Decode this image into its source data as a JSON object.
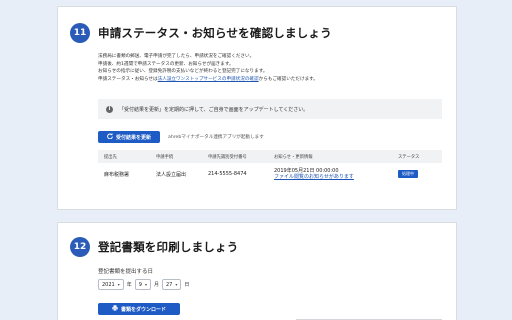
{
  "step11": {
    "number": "11",
    "title": "申請ステータス・お知らせを確認しましょう",
    "intro": [
      "法務局に書類の郵送、電子申請が完了したら、申請状況をご確認ください。",
      "申請後、約1週間で申請ステータスの更新、お知らせが届きます。",
      "お知らせの指示に従い、登録免許税の支払いなどが終わると登記完了になります。",
      "申請ステータス・お知らせは"
    ],
    "intro_link": "法人設立ワンストップサービスの申請状況の確認",
    "intro_suffix": "からもご確認いただけます。",
    "info": "「受付結果を更新」を定期的に押して、ご自身で画面をアップデートしてください。",
    "update_button": "受付結果を更新",
    "update_note": "ahrebマイナポータル連携アプリが起動します",
    "table": {
      "headers": [
        "提出先",
        "申請手続",
        "申請先識別受付番号",
        "お知らせ・更新情報",
        "ステータス"
      ],
      "row": {
        "office": "麻布税務署",
        "procedure": "法人設立届出",
        "number": "214-5555-8474",
        "date": "2019年05月21日 00:00:00",
        "notice_link": "ファイル閲覧のお知らせがあります",
        "status": "処理中"
      }
    }
  },
  "step12": {
    "number": "12",
    "title": "登記書類を印刷しましょう",
    "date_label": "登記書類を提出する日",
    "year": "2021",
    "year_unit": "年",
    "month": "9",
    "month_unit": "月",
    "day": "27",
    "day_unit": "日",
    "download_button": "書類をダウンロード"
  },
  "colors": {
    "accent": "#1f5bc4",
    "background": "#e7eef8"
  }
}
